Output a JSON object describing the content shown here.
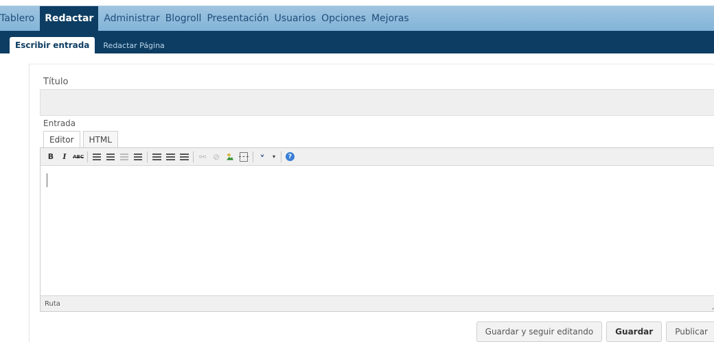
{
  "top_menu": {
    "items": [
      {
        "label": "Tablero"
      },
      {
        "label": "Redactar",
        "active": true
      },
      {
        "label": "Administrar"
      },
      {
        "label": "Blogroll"
      },
      {
        "label": "Presentación"
      },
      {
        "label": "Usuarios"
      },
      {
        "label": "Opciones"
      },
      {
        "label": "Mejoras"
      }
    ]
  },
  "sub_menu": {
    "items": [
      {
        "label": "Escribir entrada",
        "active": true
      },
      {
        "label": "Redactar Página"
      }
    ]
  },
  "form": {
    "title_label": "Título",
    "title_value": "",
    "entry_label": "Entrada",
    "tabs": [
      {
        "label": "Editor",
        "active": true
      },
      {
        "label": "HTML"
      }
    ],
    "toolbar": {
      "bold": "B",
      "italic": "I",
      "strike": "ABC",
      "spell": "ᵛ",
      "help": "?"
    },
    "path_label": "Ruta",
    "buttons": {
      "save_continue": "Guardar y seguir editando",
      "save": "Guardar",
      "publish": "Publicar"
    }
  },
  "colors": {
    "top_menu_bg": "#83b4d8",
    "dark_nav": "#0d3d62"
  }
}
